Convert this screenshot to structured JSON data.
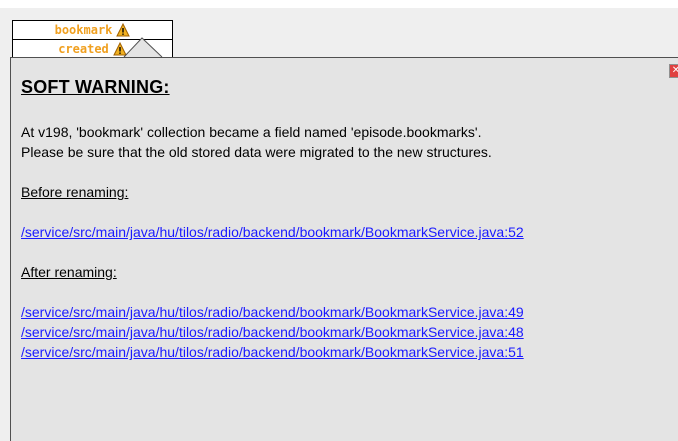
{
  "field_box": {
    "row1_label": "bookmark",
    "row2_label": "created"
  },
  "tooltip": {
    "title": "SOFT WARNING:",
    "close_label": "✕",
    "message_line1": "At v198, 'bookmark' collection became a field named 'episode.bookmarks'.",
    "message_line2": "Please be sure that the old stored data were migrated to the new structures.",
    "before_heading": "Before renaming:",
    "before_links": [
      "/service/src/main/java/hu/tilos/radio/backend/bookmark/BookmarkService.java:52"
    ],
    "after_heading": "After renaming:",
    "after_links": [
      "/service/src/main/java/hu/tilos/radio/backend/bookmark/BookmarkService.java:49",
      "/service/src/main/java/hu/tilos/radio/backend/bookmark/BookmarkService.java:48",
      "/service/src/main/java/hu/tilos/radio/backend/bookmark/BookmarkService.java:51"
    ]
  },
  "colors": {
    "field_text": "#f0a020",
    "warning_icon": "#f0b020",
    "close_button": "#e04040",
    "link": "#1a1aff",
    "tooltip_bg": "#e4e4e4"
  }
}
